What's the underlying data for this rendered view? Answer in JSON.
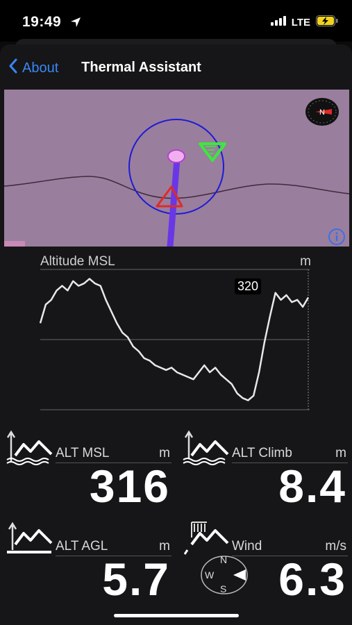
{
  "status_bar": {
    "time": "19:49",
    "network": "LTE"
  },
  "nav": {
    "back_label": "About",
    "title": "Thermal Assistant"
  },
  "map": {
    "background_color": "#9a7e9d",
    "compass_icon": "compass-icon",
    "info_icon": "info-icon"
  },
  "altitude_chart": {
    "title": "Altitude MSL",
    "unit": "m",
    "current_label": "320",
    "trace": [
      302,
      310,
      312,
      316,
      318,
      316,
      320,
      318,
      319,
      321,
      319,
      318,
      312,
      307,
      302,
      298,
      296,
      292,
      290,
      287,
      286,
      284,
      283,
      282,
      283,
      281,
      280,
      279,
      278,
      281,
      284,
      281,
      283,
      280,
      278,
      276,
      272,
      270,
      269,
      271,
      281,
      294,
      305,
      315,
      312,
      314,
      311,
      312,
      309,
      313
    ]
  },
  "tiles": [
    {
      "label": "ALT MSL",
      "unit": "m",
      "value": "316",
      "icon": "altitude-msl-icon"
    },
    {
      "label": "ALT Climb",
      "unit": "m",
      "value": "8.4",
      "icon": "altitude-climb-icon"
    },
    {
      "label": "ALT AGL",
      "unit": "m",
      "value": "5.7",
      "icon": "altitude-agl-icon"
    },
    {
      "label": "Wind",
      "unit": "m/s",
      "value": "6.3",
      "icon": "wind-icon",
      "compass": {
        "n": "N",
        "s": "S",
        "w": "W"
      }
    }
  ]
}
